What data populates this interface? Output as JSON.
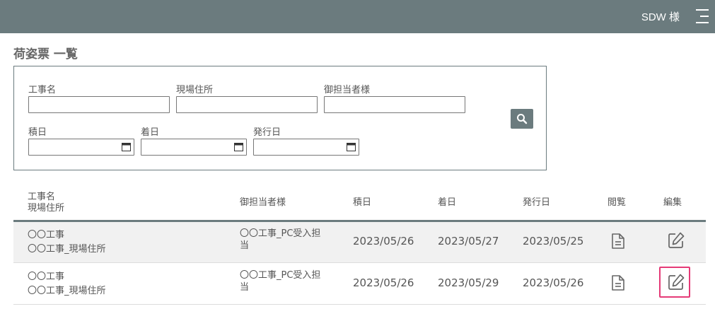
{
  "header": {
    "user_name": "SDW 様"
  },
  "page": {
    "title": "荷姿票 一覧"
  },
  "search": {
    "labels": {
      "koji_name": "工事名",
      "genba_address": "現場住所",
      "tantousha": "御担当者様",
      "tsumi_date": "積日",
      "chaku_date": "着日",
      "hakko_date": "発行日"
    }
  },
  "table": {
    "headers": {
      "koji_name": "工事名",
      "genba_address": "現場住所",
      "tantousha": "御担当者様",
      "tsumi_date": "積日",
      "chaku_date": "着日",
      "hakko_date": "発行日",
      "view": "閲覧",
      "edit": "編集"
    },
    "rows": [
      {
        "koji_name": "〇〇工事",
        "genba_address": "〇〇工事_現場住所",
        "tantousha_line1": "〇〇工事_PC受入担",
        "tantousha_line2": "当",
        "tsumi_date": "2023/05/26",
        "chaku_date": "2023/05/27",
        "hakko_date": "2023/05/25"
      },
      {
        "koji_name": "〇〇工事",
        "genba_address": "〇〇工事_現場住所",
        "tantousha_line1": "〇〇工事_PC受入担",
        "tantousha_line2": "当",
        "tsumi_date": "2023/05/26",
        "chaku_date": "2023/05/29",
        "hakko_date": "2023/05/26"
      }
    ]
  },
  "colors": {
    "header_bg": "#6b7b7e",
    "highlight": "#e53a77",
    "row_alt_bg": "#f1f1f1"
  },
  "icons": [
    "hamburger-menu-icon",
    "calendar-icon",
    "search-icon",
    "document-icon",
    "edit-icon"
  ]
}
